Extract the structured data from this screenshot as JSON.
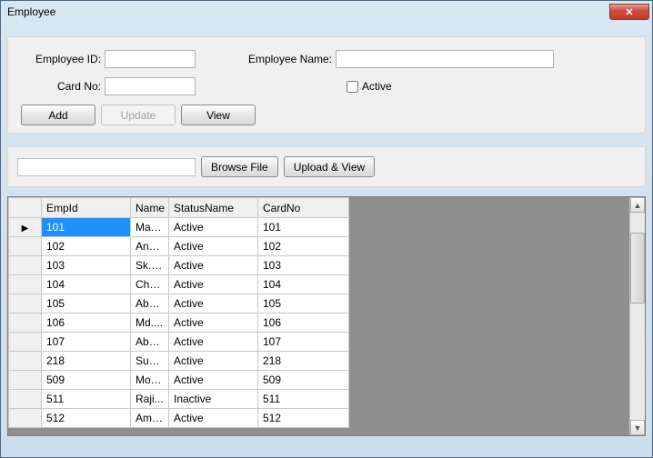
{
  "window": {
    "title": "Employee"
  },
  "form": {
    "employee_id_label": "Employee ID:",
    "employee_id_value": "",
    "employee_name_label": "Employee Name:",
    "employee_name_value": "",
    "card_no_label": "Card No:",
    "card_no_value": "",
    "active_label": "Active",
    "active_checked": false
  },
  "buttons": {
    "add": "Add",
    "update": "Update",
    "view": "View",
    "browse_file": "Browse File",
    "upload_view": "Upload & View"
  },
  "grid": {
    "headers": {
      "empid": "EmpId",
      "name": "Name",
      "status": "StatusName",
      "cardno": "CardNo"
    },
    "rows": [
      {
        "empid": "101",
        "name": "Mam...",
        "status": "Active",
        "cardno": "101"
      },
      {
        "empid": "102",
        "name": "Ano...",
        "status": "Active",
        "cardno": "102"
      },
      {
        "empid": "103",
        "name": "Sk.A...",
        "status": "Active",
        "cardno": "103"
      },
      {
        "empid": "104",
        "name": "Cha...",
        "status": "Active",
        "cardno": "104"
      },
      {
        "empid": "105",
        "name": "Abd....",
        "status": "Active",
        "cardno": "105"
      },
      {
        "empid": "106",
        "name": "Md....",
        "status": "Active",
        "cardno": "106"
      },
      {
        "empid": "107",
        "name": "Abd...",
        "status": "Active",
        "cardno": "107"
      },
      {
        "empid": "218",
        "name": "Sum...",
        "status": "Active",
        "cardno": "218"
      },
      {
        "empid": "509",
        "name": "Moh...",
        "status": "Active",
        "cardno": "509"
      },
      {
        "empid": "511",
        "name": "Raji...",
        "status": "Inactive",
        "cardno": "511"
      },
      {
        "empid": "512",
        "name": "Amz...",
        "status": "Active",
        "cardno": "512"
      }
    ],
    "selected_index": 0
  }
}
